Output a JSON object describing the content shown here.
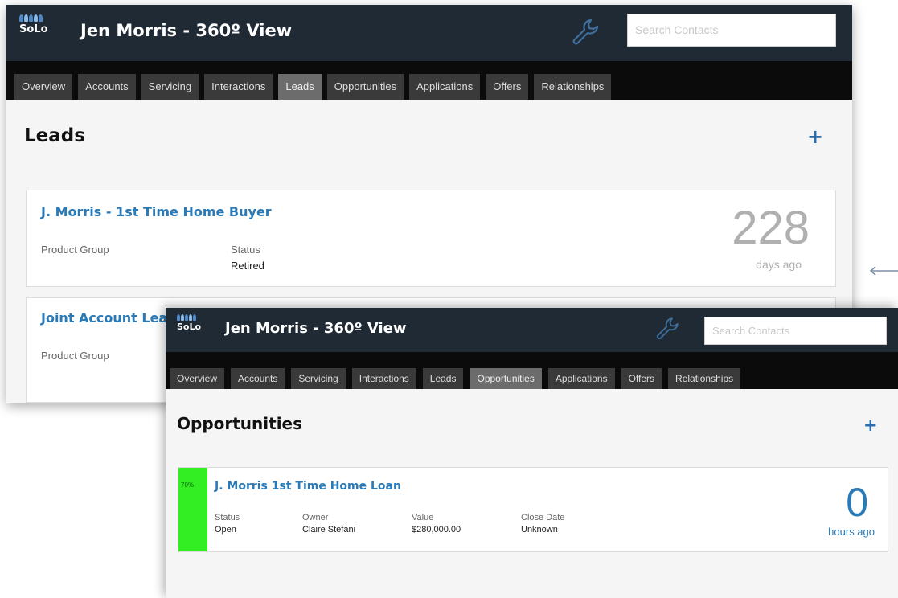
{
  "app": {
    "logo_text": "SoLo"
  },
  "leads_window": {
    "title": "Jen Morris - 360º View",
    "search_placeholder": "Search Contacts",
    "tabs": [
      "Overview",
      "Accounts",
      "Servicing",
      "Interactions",
      "Leads",
      "Opportunities",
      "Applications",
      "Offers",
      "Relationships"
    ],
    "active_tab": "Leads",
    "page_title": "Leads",
    "add_label": "+",
    "leads": [
      {
        "title": "J. Morris - 1st Time Home Buyer",
        "product_group_label": "Product Group",
        "status_label": "Status",
        "status": "Retired",
        "age_number": "228",
        "age_unit": "days ago"
      },
      {
        "title": "Joint Account Lea",
        "product_group_label": "Product Group"
      }
    ]
  },
  "opportunities_window": {
    "title": "Jen Morris - 360º View",
    "search_placeholder": "Search Contacts",
    "tabs": [
      "Overview",
      "Accounts",
      "Servicing",
      "Interactions",
      "Leads",
      "Opportunities",
      "Applications",
      "Offers",
      "Relationships"
    ],
    "active_tab": "Opportunities",
    "page_title": "Opportunities",
    "add_label": "+",
    "opportunity": {
      "probability": "70%",
      "title": "J. Morris 1st Time Home Loan",
      "status_label": "Status",
      "status": "Open",
      "owner_label": "Owner",
      "owner": "Claire Stefani",
      "value_label": "Value",
      "value": "$280,000.00",
      "close_date_label": "Close Date",
      "close_date": "Unknown",
      "age_number": "0",
      "age_unit": "hours ago"
    }
  },
  "colors": {
    "header_bg": "#1f2a35",
    "tabbar_bg": "#0b0b0b",
    "link_blue": "#2a7ab8",
    "probability_green": "#33ee22"
  },
  "icons": {
    "wrench": "wrench-icon",
    "add": "plus-icon",
    "arrow": "arrow-left-icon"
  }
}
